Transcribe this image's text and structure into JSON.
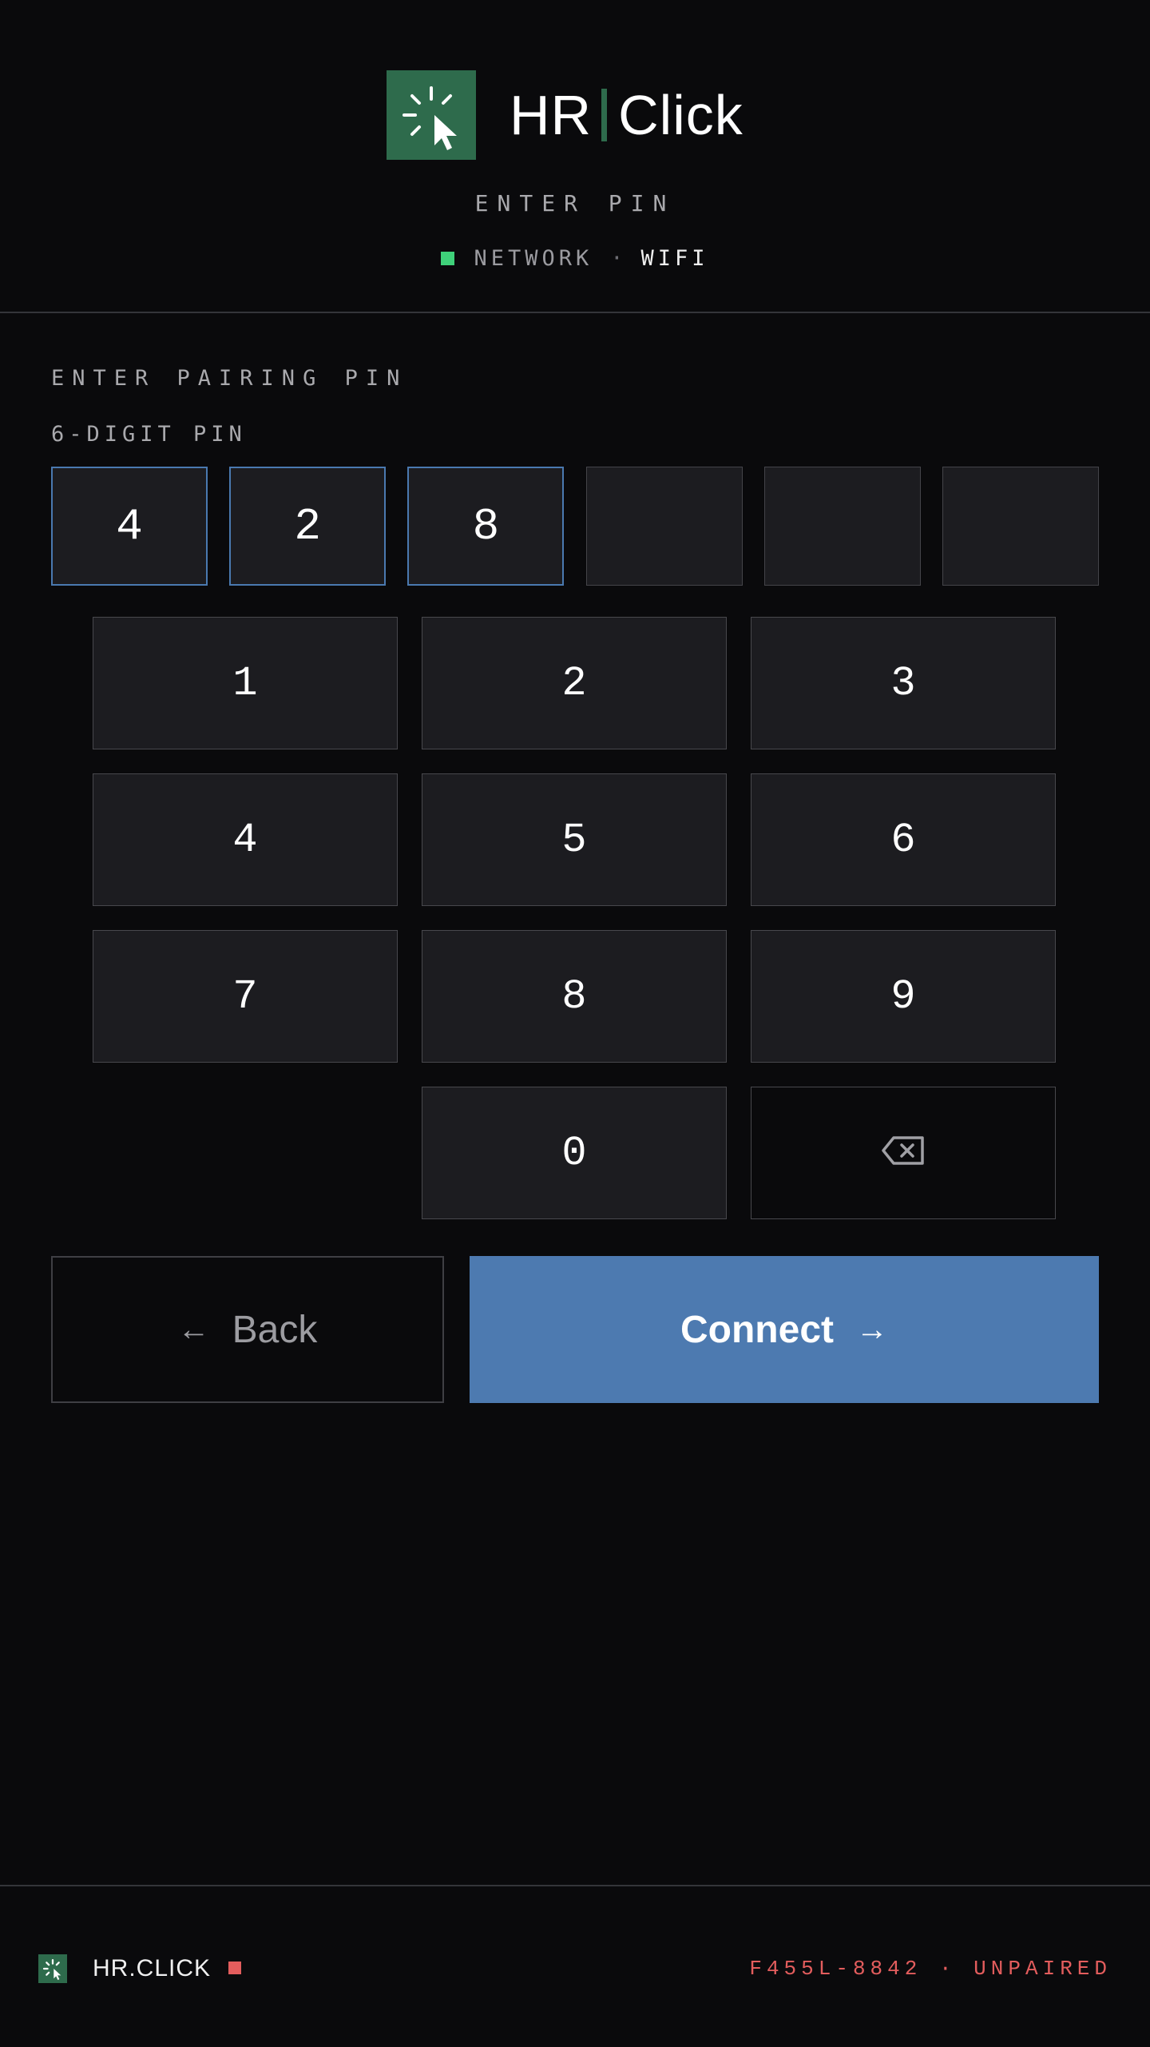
{
  "header": {
    "brand_left": "HR",
    "brand_right": "Click",
    "screen_label": "ENTER PIN",
    "network_label": "NETWORK",
    "network_sep": "·",
    "network_value": "WIFI"
  },
  "main": {
    "section_title": "ENTER PAIRING PIN",
    "pin_label": "6-DIGIT PIN",
    "pin_digits": [
      "4",
      "2",
      "8",
      "",
      "",
      ""
    ]
  },
  "keypad": {
    "keys": [
      "1",
      "2",
      "3",
      "4",
      "5",
      "6",
      "7",
      "8",
      "9",
      "0"
    ],
    "backspace_icon": "backspace-icon"
  },
  "actions": {
    "back_arrow": "←",
    "back_label": "Back",
    "connect_label": "Connect",
    "connect_arrow": "→"
  },
  "footer": {
    "brand": "HR.CLICK",
    "status": "F455L-8842 · UNPAIRED"
  },
  "colors": {
    "background": "#0a0a0c",
    "brand_green": "#2e6b4c",
    "accent_blue": "#4d7ab0",
    "network_ok": "#3fd17a",
    "status_red": "#e35d5d"
  }
}
